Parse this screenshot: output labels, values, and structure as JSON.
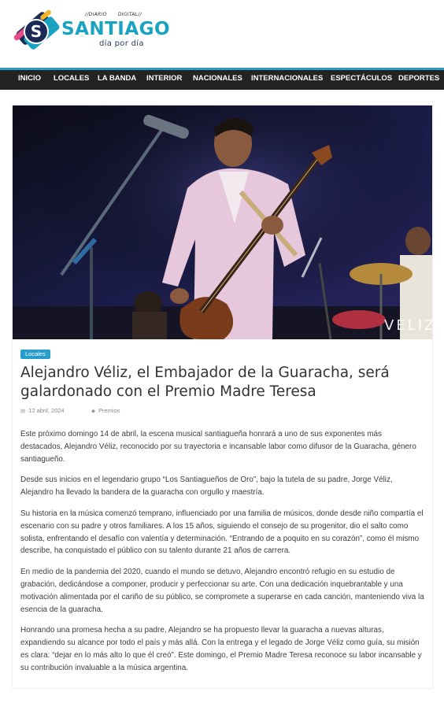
{
  "site": {
    "small_left": "//DIARIO",
    "small_right": "DIGITAL//",
    "logo_letter": "S",
    "name": "SANTIAGO",
    "tagline": "día por día"
  },
  "nav": {
    "items": [
      "INICIO",
      "LOCALES",
      "LA BANDA",
      "INTERIOR",
      "NACIONALES",
      "INTERNACIONALES",
      "ESPECTÁCULOS",
      "DEPORTES"
    ]
  },
  "article": {
    "image_watermark": "VELIZ",
    "category": "Locales",
    "title": "Alejandro Véliz, el Embajador de la Guaracha, será galardonado con el Premio Madre Teresa",
    "date": "12 abril, 2024",
    "tag": "Premios",
    "date_icon": "calendar-icon",
    "tag_icon": "tag-icon",
    "paragraphs": [
      "Este próximo domingo 14 de abril, la escena musical santiagueña honrará a uno de sus exponentes más destacados, Alejandro Véliz, reconocido por su trayectoria e incansable labor como difusor de la Guaracha, género santiagueño.",
      "Desde sus inicios en el legendario grupo “Los Santiagueños de Oro”, bajo la tutela de su padre, Jorge Véliz, Alejandro ha llevado la bandera de la guaracha con orgullo y maestría.",
      "Su historia en la música comenzó temprano, influenciado por una familia de músicos, donde desde niño compartía el escenario con su padre y otros familiares. A los 15 años, siguiendo el consejo de su progenitor, dio el salto como solista, enfrentando el desafío con valentía y determinación. “Entrando de a poquito en su corazón”, como él mismo describe, ha conquistado el público con su talento durante 21 años de carrera.",
      "En medio de la pandemia del 2020, cuando el mundo se detuvo, Alejandro encontró refugio en su estudio de grabación, dedicándose a componer, producir y perfeccionar su arte. Con una dedicación inquebrantable y una motivación alimentada por el cariño de su público, se compromete a superarse en cada canción, manteniendo viva la esencia de la guaracha.",
      "Honrando una promesa hecha a su padre, Alejandro se ha propuesto llevar la guaracha a nuevas alturas, expandiendo su alcance por todo el país y más allá. Con la entrega y el legado de Jorge Véliz como guía, su misión es clara: “dejar en lo más alto lo que él creó”. Este domingo, el Premio Madre Teresa reconoce su labor incansable y su contribución invaluable a la música argentina."
    ]
  },
  "colors": {
    "accent": "#289dcc",
    "nav_bg": "#232323",
    "logo_text": "#19a3c0"
  }
}
